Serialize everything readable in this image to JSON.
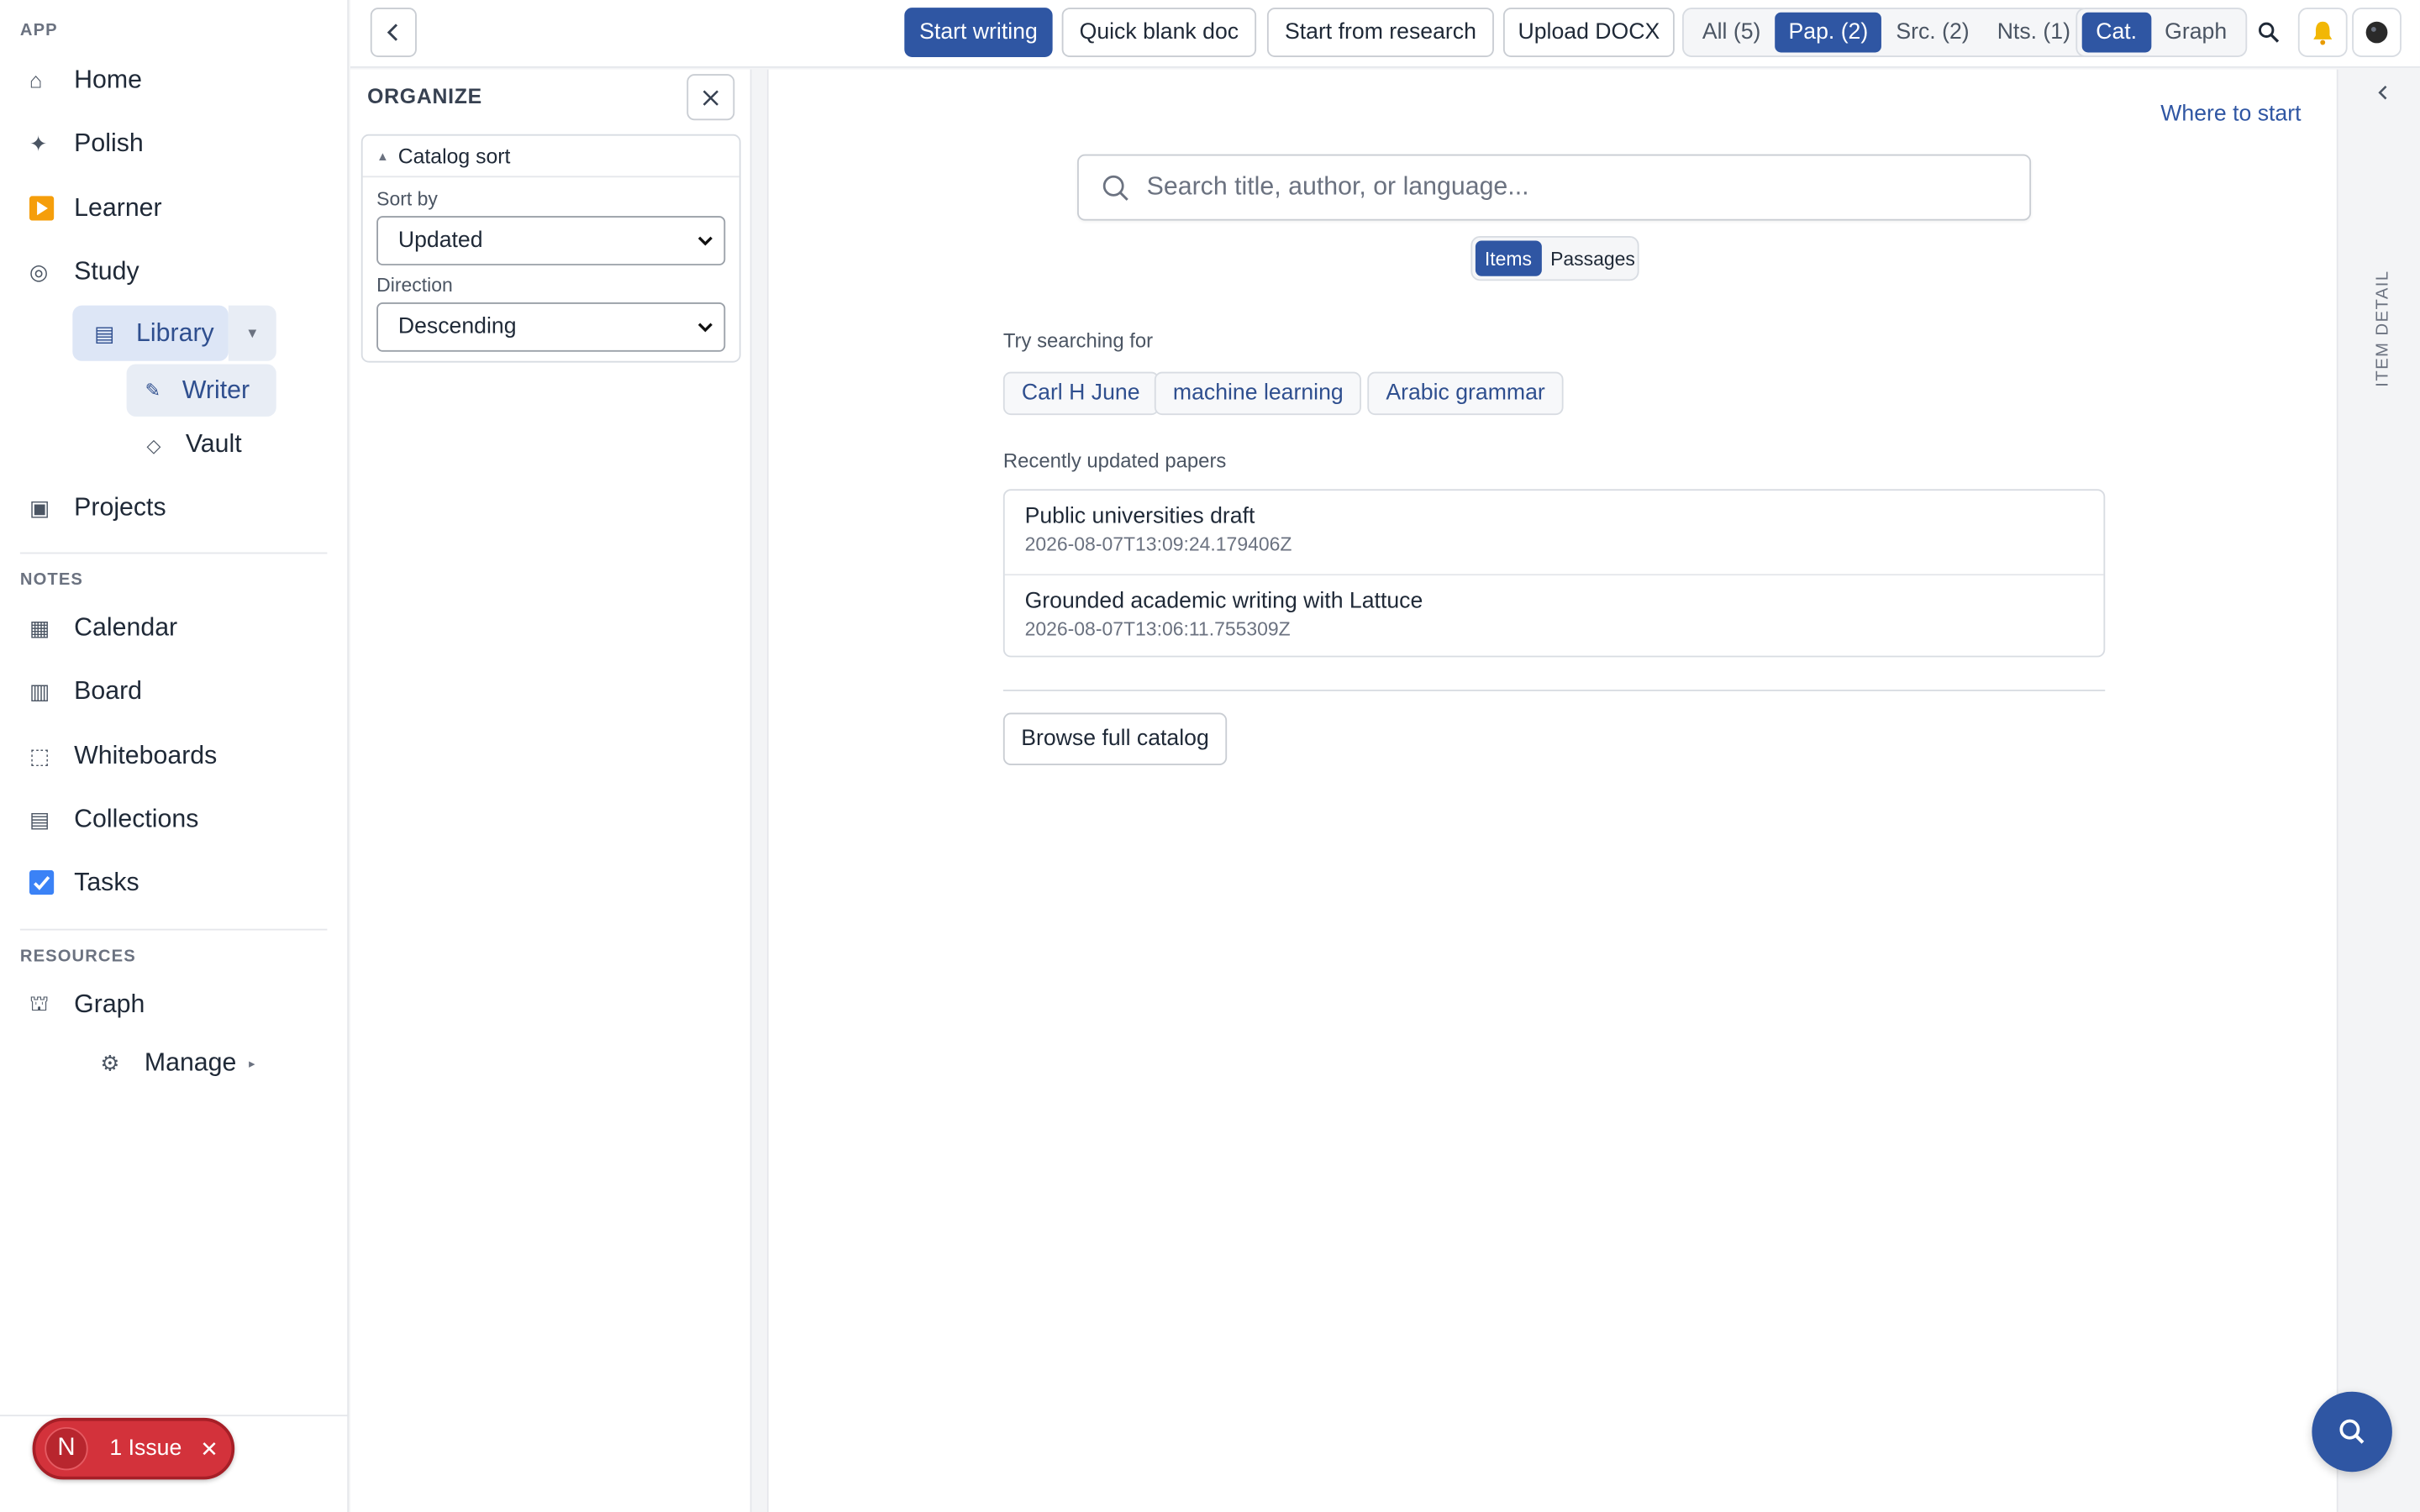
{
  "sidebar": {
    "app_heading": "APP",
    "app_items": [
      {
        "label": "Home",
        "icon": "home-icon"
      },
      {
        "label": "Polish",
        "icon": "sparkle-icon"
      },
      {
        "label": "Learner",
        "icon": "play-icon"
      },
      {
        "label": "Study",
        "icon": "target-icon"
      }
    ],
    "library": {
      "label": "Library",
      "icon": "list-icon"
    },
    "writer": {
      "label": "Writer",
      "icon": "pencil-icon"
    },
    "vault": {
      "label": "Vault",
      "icon": "diamond-icon"
    },
    "projects": {
      "label": "Projects",
      "icon": "square-icon"
    },
    "notes_heading": "NOTES",
    "notes_items": [
      {
        "label": "Calendar",
        "icon": "calendar-icon"
      },
      {
        "label": "Board",
        "icon": "board-icon"
      },
      {
        "label": "Whiteboards",
        "icon": "whiteboard-icon"
      },
      {
        "label": "Collections",
        "icon": "collections-icon"
      },
      {
        "label": "Tasks",
        "icon": "checkbox-icon"
      }
    ],
    "resources_heading": "RESOURCES",
    "graph": {
      "label": "Graph",
      "icon": "graph-icon"
    },
    "manage": {
      "label": "Manage",
      "icon": "gear-icon"
    }
  },
  "issue_badge": {
    "letter": "N",
    "text": "1 Issue",
    "color": "#d3323b"
  },
  "topbar": {
    "start_writing": "Start writing",
    "quick_blank": "Quick blank doc",
    "start_research": "Start from research",
    "upload_docx": "Upload DOCX",
    "filters": [
      {
        "label": "All (5)",
        "active": false
      },
      {
        "label": "Pap. (2)",
        "active": true
      },
      {
        "label": "Src. (2)",
        "active": false
      },
      {
        "label": "Nts. (1)",
        "active": false
      }
    ],
    "views": [
      {
        "label": "Cat.",
        "active": true
      },
      {
        "label": "Graph",
        "active": false
      }
    ]
  },
  "organize": {
    "title": "ORGANIZE",
    "card_title": "Catalog sort",
    "sort_by_label": "Sort by",
    "sort_by_value": "Updated",
    "direction_label": "Direction",
    "direction_value": "Descending"
  },
  "main": {
    "where_to_start": "Where to start",
    "search_placeholder": "Search title, author, or language...",
    "modes": [
      {
        "label": "Items",
        "active": true
      },
      {
        "label": "Passages",
        "active": false
      }
    ],
    "try_label": "Try searching for",
    "suggestions": [
      "Carl H June",
      "machine learning",
      "Arabic grammar"
    ],
    "recent_label": "Recently updated papers",
    "recent": [
      {
        "title": "Public universities draft",
        "date": "2026-08-07T13:09:24.179406Z"
      },
      {
        "title": "Grounded academic writing with Lattuce",
        "date": "2026-08-07T13:06:11.755309Z"
      }
    ],
    "browse_label": "Browse full catalog"
  },
  "rail": {
    "label": "ITEM DETAIL"
  },
  "colors": {
    "accent": "#2f56a3",
    "accent_light": "#dde6f6",
    "danger": "#d3323b",
    "bell": "#f2b705"
  }
}
